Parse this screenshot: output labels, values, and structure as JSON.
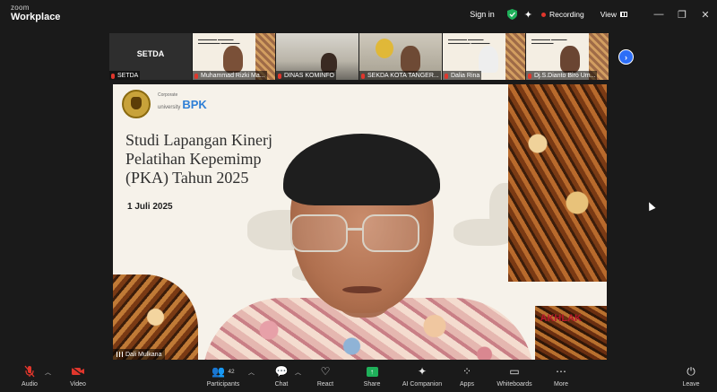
{
  "titlebar": {
    "brand_top": "zoom",
    "brand_bottom": "Workplace",
    "signin": "Sign in",
    "recording": "Recording",
    "view": "View"
  },
  "gallery": {
    "tiles": [
      {
        "title": "SETDA",
        "name": "SETDA"
      },
      {
        "name": "Muhammad Rizki Ma..."
      },
      {
        "name": "DINAS KOMINFO"
      },
      {
        "name": "SEKDA KOTA TANGER..."
      },
      {
        "name": "Dalia Rina"
      },
      {
        "name": "Dj.S.Dianto Biro Um..."
      }
    ]
  },
  "slide": {
    "corp_small": "Corporate",
    "corp_univ": "university",
    "corp_brand": "BPK",
    "title_line1": "Studi Lapangan Kinerj",
    "title_line2": "Pelatihan Kepemimp",
    "title_line3": "(PKA) Tahun 2025",
    "date": "1 Juli 2025",
    "akhlak": "AKHLAK"
  },
  "speaker": {
    "name": "Dali Mulkana"
  },
  "toolbar": {
    "audio": "Audio",
    "video": "Video",
    "participants": "Participants",
    "participants_count": "42",
    "chat": "Chat",
    "react": "React",
    "share": "Share",
    "ai": "AI Companion",
    "apps": "Apps",
    "whiteboards": "Whiteboards",
    "more": "More",
    "leave": "Leave"
  },
  "colors": {
    "accent_blue": "#2d6ef7",
    "share_green": "#1fb05a",
    "record_red": "#e0362c",
    "bpk_blue": "#2e7fd6",
    "akhlak_red": "#b5162b",
    "active_speaker": "#f0e33a"
  }
}
